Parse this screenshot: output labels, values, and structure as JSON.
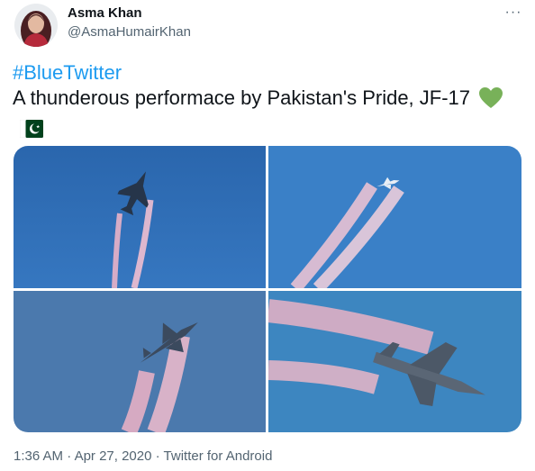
{
  "author": {
    "name": "Asma Khan",
    "handle": "@AsmaHumairKhan"
  },
  "menu": {
    "more_label": "···"
  },
  "tweet": {
    "hashtag": "#BlueTwitter",
    "text": "A thunderous performace by Pakistan's Pride, JF-17"
  },
  "icons": {
    "heart": "green-heart-icon",
    "flag": "pakistan-flag-icon",
    "heart_color": "#78b159",
    "flag_green": "#01411c"
  },
  "media": {
    "photos": [
      {
        "name": "photo-jet-climbing-smoke",
        "sky": "#2f6db3"
      },
      {
        "name": "photo-jet-high-smoke",
        "sky": "#3a7fc6"
      },
      {
        "name": "photo-jet-diving-smoke",
        "sky": "#4a78ad"
      },
      {
        "name": "photo-jet-closeup-smoke",
        "sky": "#3b84bf"
      }
    ]
  },
  "footer": {
    "time": "1:36 AM",
    "sep1": " · ",
    "date": "Apr 27, 2020",
    "sep2": " · ",
    "source": "Twitter for Android"
  }
}
